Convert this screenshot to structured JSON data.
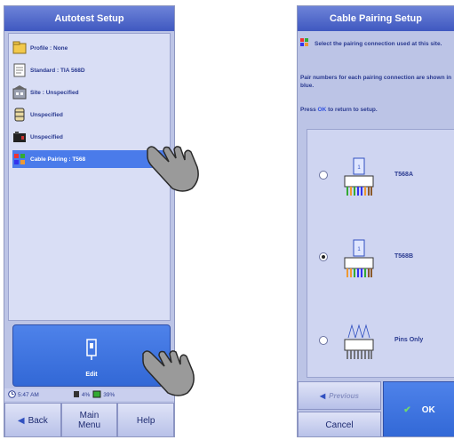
{
  "left": {
    "title": "Autotest Setup",
    "items": [
      {
        "label": "Profile : None",
        "icon": "profile-icon"
      },
      {
        "label": "Standard : TIA 568D",
        "icon": "document-icon"
      },
      {
        "label": "Site : Unspecified",
        "icon": "building-icon"
      },
      {
        "label": "Unspecified",
        "icon": "cable-reel-icon"
      },
      {
        "label": "Unspecified",
        "icon": "tester-icon"
      },
      {
        "label": "Cable Pairing : T568",
        "icon": "pairing-icon"
      }
    ],
    "edit_label": "Edit",
    "status": {
      "time": "5:47 AM",
      "batt1": "4%",
      "batt2": "39%"
    },
    "buttons": {
      "back": "Back",
      "main_menu": "Main Menu",
      "help": "Help"
    }
  },
  "right": {
    "title": "Cable Pairing Setup",
    "intro": "Select the pairing connection used at this site.",
    "pair_note": "Pair numbers for each pairing connection are shown in blue.",
    "press_prefix": "Press",
    "press_ok": "OK",
    "press_suffix": "to return to setup.",
    "schemes": [
      {
        "label": "T568A",
        "selected": false
      },
      {
        "label": "T568B",
        "selected": true
      },
      {
        "label": "Pins Only",
        "selected": false
      }
    ],
    "buttons": {
      "previous": "Previous",
      "ok": "OK",
      "cancel": "Cancel"
    }
  },
  "colors": {
    "accent": "#4a7bea",
    "title_bar": "#3f58c0",
    "panel_bg": "#bcc4e6"
  }
}
